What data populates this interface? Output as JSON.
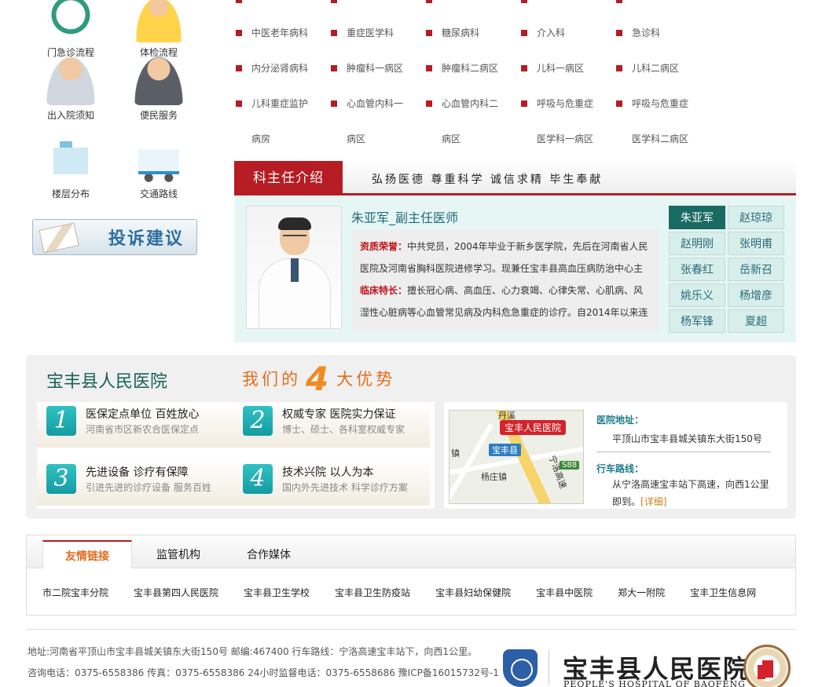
{
  "quick_links": [
    {
      "label": "门急诊流程",
      "icon": "clock-icon"
    },
    {
      "label": "体检流程",
      "icon": "person-icon"
    },
    {
      "label": "出入院须知",
      "icon": "doctor-icon"
    },
    {
      "label": "便民服务",
      "icon": "doctor-stethoscope-icon"
    },
    {
      "label": "楼层分布",
      "icon": "building-icon"
    },
    {
      "label": "交通路线",
      "icon": "ambulance-icon"
    }
  ],
  "complaint_label": "投诉建议",
  "departments": [
    [
      "中医老年病科",
      "重症医学科",
      "糖尿病科",
      "介入科",
      "急诊科"
    ],
    [
      "内分泌肾病科",
      "肿瘤科一病区",
      "肿瘤科二病区",
      "儿科一病区",
      "儿科二病区"
    ],
    [
      "儿科重症监护",
      "心血管内科一",
      "心血管内科二",
      "呼吸与危重症",
      "呼吸与危重症"
    ],
    [
      "病房",
      "病区",
      "病区",
      "医学科一病区",
      "医学科二病区"
    ]
  ],
  "director": {
    "tab": "科主任介绍",
    "slogan": "弘扬医德 尊重科学 诚信求精 毕生奉献",
    "name_title": "朱亚军_副主任医师",
    "honor_label": "资质荣誉：",
    "honor_text": "中共党员，2004年毕业于新乡医学院，先后在河南省人民医院及河南省胸科医院进修学习。现兼任宝丰县高血压病防治中心主",
    "special_label": "临床特长：",
    "special_text": "擅长冠心病、高血压、心力衰竭、心律失常、心肌病、风湿性心脏病等心血管常见病及内科危急重症的诊疗。自2014年以来连",
    "doctors": [
      "朱亚军",
      "赵琼琼",
      "赵明刚",
      "张明甫",
      "张春红",
      "岳新召",
      "姚乐义",
      "杨增彦",
      "杨军锋",
      "夏超"
    ]
  },
  "advantages": {
    "hospital": "宝丰县人民医院",
    "slogan_pre": "我们的",
    "slogan_num": "4",
    "slogan_post": "大优势",
    "items": [
      {
        "num": "1",
        "title": "医保定点单位  百姓放心",
        "desc": "河南省市区新农合医保定点"
      },
      {
        "num": "2",
        "title": "权威专家  医院实力保证",
        "desc": "博士、硕士、各科室权威专家"
      },
      {
        "num": "3",
        "title": "先进设备  诊疗有保障",
        "desc": "引进先进的诊疗设备  服务百姓"
      },
      {
        "num": "4",
        "title": "技术兴院  以人为本",
        "desc": "国内外先进技术  科学诊疗方案"
      }
    ],
    "map": {
      "pin": "宝丰人民医院",
      "town": "宝丰县",
      "place": "杨庄镇",
      "road": "宁洛高速",
      "code": "S88",
      "edge": "镇",
      "top": "丹溪"
    },
    "address_label": "医院地址：",
    "address": "平顶山市宝丰县城关镇东大街150号",
    "route_label": "行车路线：",
    "route": "从宁洛高速宝丰站下高速，向西1公里即到。",
    "more": "[详细]"
  },
  "links": {
    "tabs": [
      "友情链接",
      "监管机构",
      "合作媒体"
    ],
    "items": [
      "市二院宝丰分院",
      "宝丰县第四人民医院",
      "宝丰县卫生学校",
      "宝丰县卫生防疫站",
      "宝丰县妇幼保健院",
      "宝丰县中医院",
      "郑大一附院",
      "宝丰卫生信息网"
    ]
  },
  "footer": {
    "line1": "地址:河南省平顶山市宝丰县城关镇东大街150号 邮编:467400 行车路线：宁洛高速宝丰站下，向西1公里。",
    "line2": "咨询电话：0375-6558386 传真：0375-6558386 24小时监督电话：0375-6558686 豫ICP备16015732号-1",
    "cn_name": "宝丰县人民医院",
    "en_name": "PEOPLE'S HOSPITAL OF BAOFENG"
  },
  "colors": {
    "brand_red": "#b51c23",
    "teal": "#196a62",
    "orange": "#e36d1c"
  }
}
